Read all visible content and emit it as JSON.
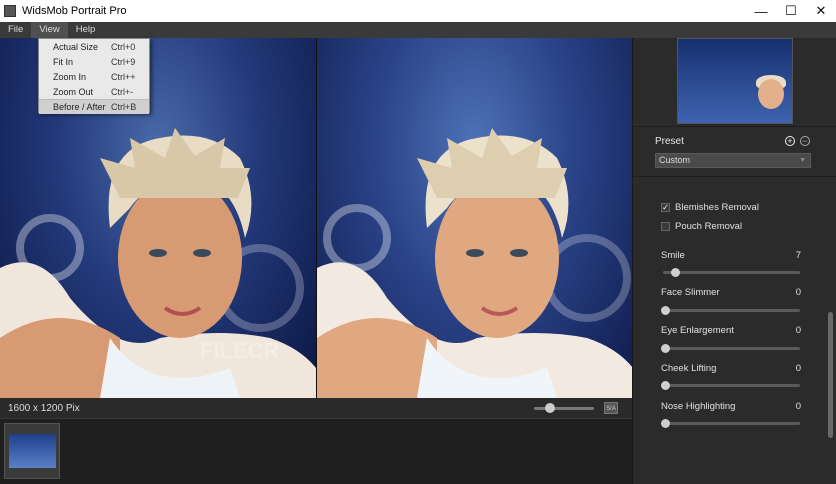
{
  "window": {
    "title": "WidsMob Portrait Pro",
    "minimize": "—",
    "maximize": "☐",
    "close": "✕"
  },
  "menu": {
    "items": [
      "File",
      "View",
      "Help"
    ],
    "active": "View",
    "dropdown": [
      {
        "label": "Actual Size",
        "shortcut": "Ctrl+0"
      },
      {
        "label": "Fit In",
        "shortcut": "Ctrl+9"
      },
      {
        "label": "Zoom In",
        "shortcut": "Ctrl++"
      },
      {
        "label": "Zoom Out",
        "shortcut": "Ctrl+-"
      },
      {
        "label": "Before / After",
        "shortcut": "Ctrl+B"
      }
    ]
  },
  "status": {
    "dimensions": "1600 x 1200 Pix",
    "split_button": "S/A",
    "zoom_fraction": 0.2
  },
  "watermark": "FILECR",
  "panel": {
    "preset_label": "Preset",
    "preset_value": "Custom",
    "checkboxes": [
      {
        "label": "Blemishes Removal",
        "checked": true
      },
      {
        "label": "Pouch Removal",
        "checked": false
      }
    ],
    "sliders": [
      {
        "label": "Smile",
        "value": "7"
      },
      {
        "label": "Face Slimmer",
        "value": "0"
      },
      {
        "label": "Eye Enlargement",
        "value": "0"
      },
      {
        "label": "Cheek Lifting",
        "value": "0"
      },
      {
        "label": "Nose Highlighting",
        "value": "0"
      }
    ]
  },
  "colors": {
    "background": "#2b2b2b",
    "menubar": "#3a3a3a",
    "accent_knob": "#cfcfcf"
  },
  "icons": {
    "add_preset": "plus-circle-icon",
    "remove_preset": "minus-circle-icon",
    "dropdown_arrow": "chevron-down-icon"
  }
}
